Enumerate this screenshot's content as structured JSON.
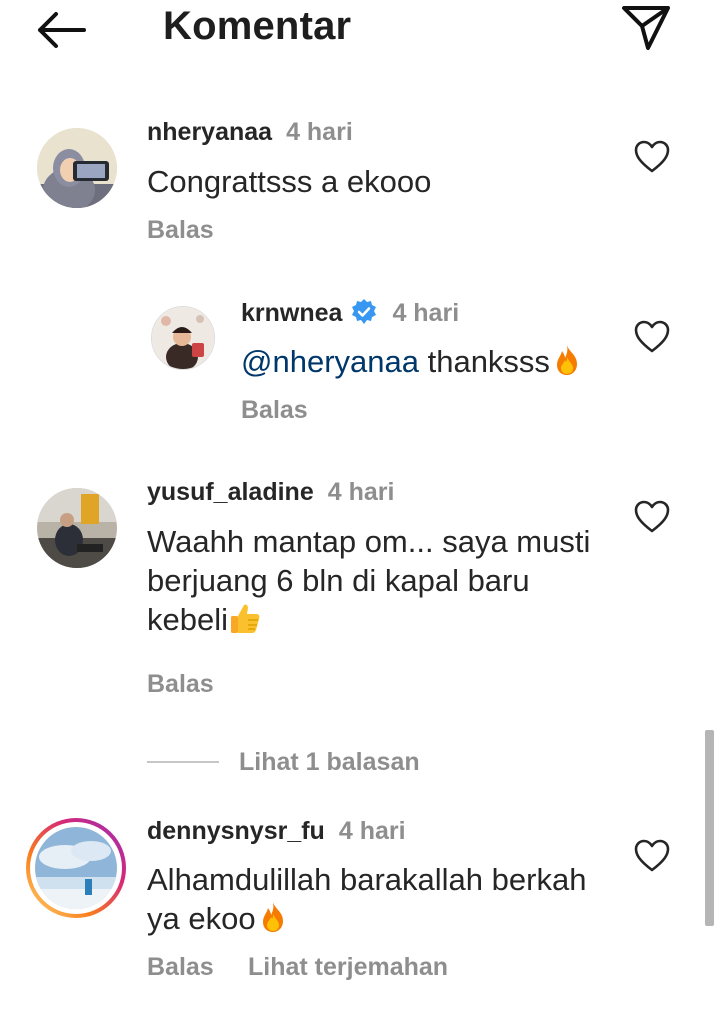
{
  "header": {
    "title": "Komentar",
    "back_icon": "arrow-left-icon",
    "send_icon": "paper-plane-icon"
  },
  "comments": [
    {
      "username": "nheryanaa",
      "time": "4 hari",
      "text": "Congrattsss a ekooo",
      "reply_label": "Balas"
    },
    {
      "username": "krnwnea",
      "verified": true,
      "time": "4 hari",
      "mention": "@nheryanaa",
      "text": " thanksss",
      "emoji": "fire",
      "reply_label": "Balas"
    },
    {
      "username": "yusuf_aladine",
      "time": "4 hari",
      "text_line1": "Waahh mantap om... saya musti",
      "text_line2": "berjuang 6 bln di kapal baru",
      "text_line3": "kebeli",
      "emoji": "thumbs-up",
      "reply_label": "Balas",
      "view_replies_label": "Lihat 1 balasan"
    },
    {
      "username": "dennysnysr_fu",
      "time": "4 hari",
      "text_line1": "Alhamdulillah barakallah berkah",
      "text_line2": "ya ekoo",
      "emoji": "fire",
      "reply_label": "Balas",
      "translate_label": "Lihat terjemahan",
      "has_story_ring": true
    }
  ],
  "colors": {
    "text": "#262626",
    "secondary": "#8e8e8e",
    "mention": "#00376b",
    "verified": "#3897f0"
  }
}
